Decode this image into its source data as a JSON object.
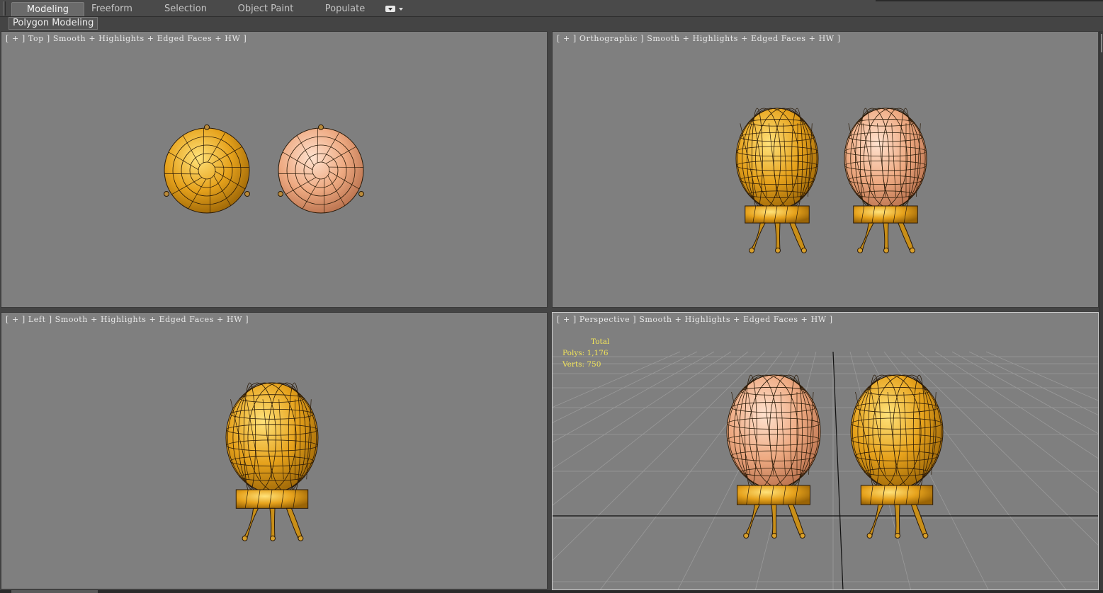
{
  "ribbon": {
    "tabs": [
      {
        "label": "Modeling",
        "active": true
      },
      {
        "label": "Freeform",
        "active": false
      },
      {
        "label": "Selection",
        "active": false
      },
      {
        "label": "Object Paint",
        "active": false
      },
      {
        "label": "Populate",
        "active": false
      }
    ],
    "more_icon": "camera-dropdown-icon",
    "panel_label": "Polygon Modeling"
  },
  "viewports": {
    "top": {
      "label": "[ + ] Top ] Smooth + Highlights + Edged Faces + HW ]"
    },
    "orthographic": {
      "label": "[ + ] Orthographic ] Smooth + Highlights + Edged Faces + HW ]"
    },
    "left": {
      "label": "[ + ] Left ] Smooth + Highlights + Edged Faces + HW ]"
    },
    "perspective": {
      "label": "[ + ] Perspective ] Smooth + Highlights + Edged Faces + HW ]",
      "stats": {
        "header": "Total",
        "polys": "Polys: 1,176",
        "verts": "Verts: 750"
      }
    }
  },
  "colors": {
    "viewport_bg": "#7f7f7f",
    "gold_egg": "#e6a21c",
    "pink_egg": "#eeaa82",
    "stats_text": "#f2e45a"
  }
}
